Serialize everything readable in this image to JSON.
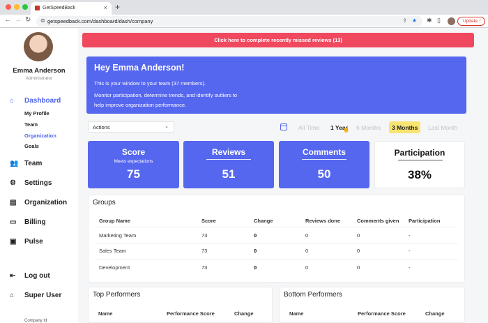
{
  "browser": {
    "tab_title": "GetSpeedBack",
    "url": "getspeedback.com/dashboard/dash/company",
    "update_label": "Update"
  },
  "sidebar": {
    "user_name": "Emma Anderson",
    "user_role": "Administrator",
    "nav": [
      {
        "label": "Dashboard",
        "icon": "home-icon"
      },
      {
        "label": "Team",
        "icon": "users-icon"
      },
      {
        "label": "Settings",
        "icon": "gear-icon"
      },
      {
        "label": "Organization",
        "icon": "briefcase-icon"
      },
      {
        "label": "Billing",
        "icon": "credit-card-icon"
      },
      {
        "label": "Pulse",
        "icon": "pulse-icon"
      },
      {
        "label": "Log out",
        "icon": "logout-icon"
      },
      {
        "label": "Super User",
        "icon": "home-icon"
      }
    ],
    "sub_items": [
      "My Profile",
      "Team",
      "Organization",
      "Goals"
    ],
    "company_id_label": "Company Id"
  },
  "alert": {
    "text": "Click here to complete recently missed reviews (13)"
  },
  "hero": {
    "title": "Hey Emma Anderson!",
    "subtitle": "This is your window to your team (37 members).",
    "description": "Monitor participation, determine trends, and identify outliers to help improve organization performance."
  },
  "filters": {
    "actions_label": "Actions",
    "ranges": [
      "All Time",
      "1 Year",
      "6 Months",
      "3 Months",
      "Last Month"
    ],
    "selected_range": "3 Months"
  },
  "stats": {
    "score": {
      "title": "Score",
      "caption": "Meets expectations",
      "value": "75"
    },
    "reviews": {
      "title": "Reviews",
      "value": "51"
    },
    "comments": {
      "title": "Comments",
      "value": "50"
    },
    "participation": {
      "title": "Participation",
      "value": "38%"
    }
  },
  "groups": {
    "title": "Groups",
    "columns": [
      "Group Name",
      "Score",
      "Change",
      "Reviews done",
      "Comments given",
      "Participation"
    ],
    "rows": [
      [
        "Marketing Team",
        "73",
        "0",
        "0",
        "0",
        "-"
      ],
      [
        "Sales Team",
        "73",
        "0",
        "0",
        "0",
        "-"
      ],
      [
        "Development",
        "73",
        "0",
        "0",
        "0",
        "-"
      ]
    ]
  },
  "top_performers": {
    "title": "Top Performers",
    "columns": [
      "Name",
      "Performance Score",
      "Change"
    ]
  },
  "bottom_performers": {
    "title": "Bottom Performers",
    "columns": [
      "Name",
      "Performance Score",
      "Change"
    ]
  },
  "colors": {
    "primary": "#5566ef",
    "alert": "#f0485e",
    "highlight": "#f8e472"
  }
}
